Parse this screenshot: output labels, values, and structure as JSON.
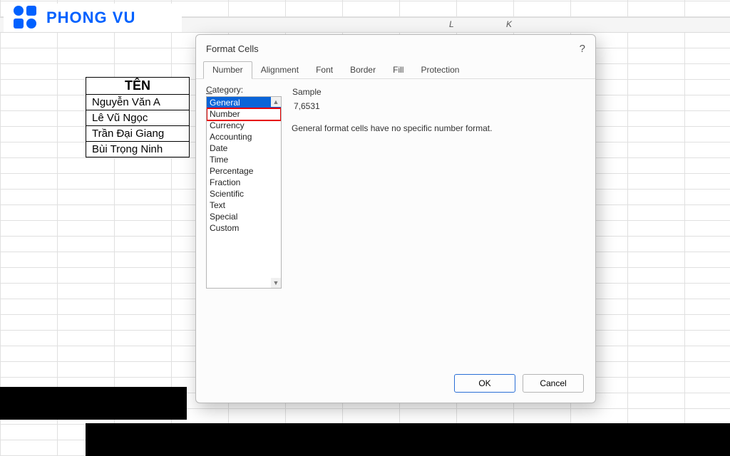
{
  "logo": {
    "text": "PHONG VU"
  },
  "col_letters": {
    "l": "L",
    "k": "K"
  },
  "table": {
    "header": "TÊN",
    "rows": [
      "Nguyễn Văn A",
      "Lê Vũ Ngọc",
      "Trần Đại Giang",
      "Bùi Trọng Ninh"
    ]
  },
  "dialog": {
    "title": "Format Cells",
    "help": "?",
    "tabs": [
      "Number",
      "Alignment",
      "Font",
      "Border",
      "Fill",
      "Protection"
    ],
    "category_label_pre": "C",
    "category_label_post": "ategory:",
    "categories": [
      "General",
      "Number",
      "Currency",
      "Accounting",
      "Date",
      "Time",
      "Percentage",
      "Fraction",
      "Scientific",
      "Text",
      "Special",
      "Custom"
    ],
    "selected_category": "General",
    "highlighted_category": "Number",
    "sample_label": "Sample",
    "sample_value": "7,6531",
    "description": "General format cells have no specific number format.",
    "ok": "OK",
    "cancel": "Cancel"
  }
}
